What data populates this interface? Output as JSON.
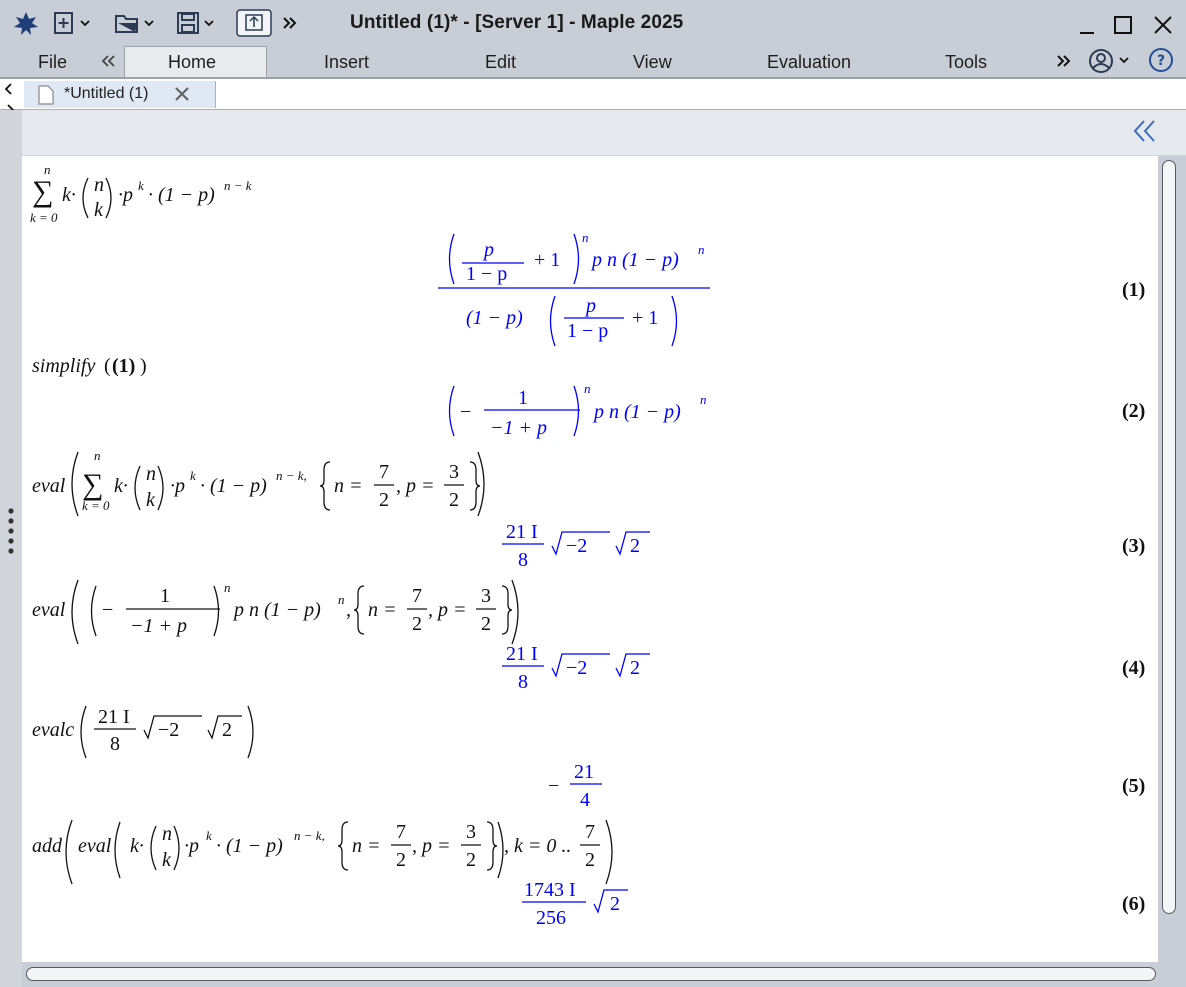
{
  "window": {
    "title": "Untitled (1)* - [Server 1] - Maple 2025"
  },
  "menu": {
    "file": "File",
    "tabs": [
      "Home",
      "Insert",
      "Edit",
      "View",
      "Evaluation",
      "Tools"
    ]
  },
  "document": {
    "tab_label": "*Untitled (1)"
  },
  "worksheet": {
    "input1": {
      "sum_upper": "n",
      "sum_lower": "k = 0",
      "sum_symbol": "∑",
      "expr_a": "k·",
      "binom_top": "n",
      "binom_bottom": "k",
      "expr_b": "·p",
      "pow_k": "k",
      "expr_c": "· (1 − p)",
      "pow_nk": "n − k"
    },
    "output1": {
      "num_frac_top": "p",
      "num_frac_bottom": "1 − p",
      "plus_one": "+ 1",
      "pow_n": "n",
      "tail": "p n (1 − p)",
      "tail_pow": "n",
      "den_head": "(1 − p)",
      "den_frac_top": "p",
      "den_frac_bottom": "1 − p",
      "den_plus": "+ 1",
      "label": "(1)"
    },
    "input2": {
      "fn": "simplify",
      "arg": "(1)"
    },
    "output2": {
      "minus": "−",
      "frac_top": "1",
      "frac_bottom": "−1 + p",
      "pow_n": "n",
      "tail": "p n (1 − p)",
      "tail_pow": "n",
      "label": "(2)"
    },
    "input3": {
      "fn": "eval",
      "sum_upper": "n",
      "sum_lower": "k = 0",
      "expr_a": "k·",
      "binom_top": "n",
      "binom_bottom": "k",
      "expr_b": "·p",
      "pow_k": "k",
      "expr_c": "· (1 − p)",
      "pow_nk": "n − k,",
      "n_eq": "n =",
      "n_top": "7",
      "n_bottom": "2",
      "p_eq": ", p =",
      "p_top": "3",
      "p_bottom": "2"
    },
    "output3": {
      "frac_top": "21 I",
      "frac_bottom": "8",
      "rad1": "−2",
      "rad2": "2",
      "label": "(3)"
    },
    "input4": {
      "fn": "eval",
      "minus": "−",
      "frac_top": "1",
      "frac_bottom": "−1 + p",
      "pow_n": "n",
      "tail": "p n (1 − p)",
      "tail_pow": "n",
      "comma": ",",
      "n_eq": "n =",
      "n_top": "7",
      "n_bottom": "2",
      "p_eq": ", p =",
      "p_top": "3",
      "p_bottom": "2"
    },
    "output4": {
      "frac_top": "21 I",
      "frac_bottom": "8",
      "rad1": "−2",
      "rad2": "2",
      "label": "(4)"
    },
    "input5": {
      "fn": "evalc",
      "frac_top": "21 I",
      "frac_bottom": "8",
      "rad1": "−2",
      "rad2": "2"
    },
    "output5": {
      "minus": "−",
      "frac_top": "21",
      "frac_bottom": "4",
      "label": "(5)"
    },
    "input6": {
      "fn": "add",
      "fn2": "eval",
      "expr_a": "k·",
      "binom_top": "n",
      "binom_bottom": "k",
      "expr_b": "·p",
      "pow_k": "k",
      "expr_c": "· (1 − p)",
      "pow_nk": "n − k,",
      "n_eq": "n =",
      "n_top": "7",
      "n_bottom": "2",
      "p_eq": ", p =",
      "p_top": "3",
      "p_bottom": "2",
      "range": ", k = 0 ..",
      "r_top": "7",
      "r_bottom": "2"
    },
    "output6": {
      "frac_top": "1743 I",
      "frac_bottom": "256",
      "rad": "2",
      "label": "(6)"
    }
  },
  "colors": {
    "output": "#0000ff",
    "input": "#111111",
    "chrome": "#c9ced6"
  }
}
